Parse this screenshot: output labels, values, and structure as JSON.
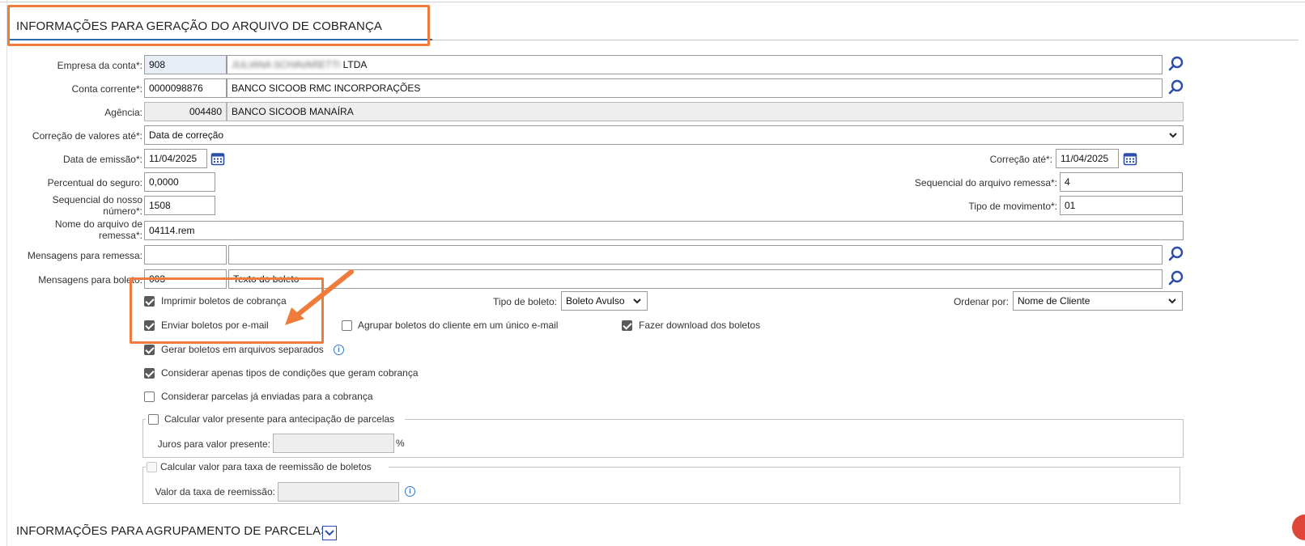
{
  "section": {
    "title": "INFORMAÇÕES PARA GERAÇÃO DO ARQUIVO DE COBRANÇA",
    "next_title": "INFORMAÇÕES PARA AGRUPAMENTO DE PARCELAS"
  },
  "empresa": {
    "label": "Empresa da conta*:",
    "code": "908",
    "name_blurred": "JULIANA SCHAVARETTI",
    "name_suffix": "LTDA"
  },
  "conta": {
    "label": "Conta corrente*:",
    "code": "0000098876",
    "name": "BANCO SICOOB RMC INCORPORAÇÕES"
  },
  "agencia": {
    "label": "Agência:",
    "code": "004480",
    "name": "BANCO SICOOB MANAÍRA"
  },
  "correcao_valores": {
    "label": "Correção de valores até*:",
    "value": "Data de correção"
  },
  "data_emissao": {
    "label": "Data de emissão*:",
    "value": "11/04/2025"
  },
  "correcao_ate": {
    "label": "Correção até*:",
    "value": "11/04/2025"
  },
  "percentual_seguro": {
    "label": "Percentual do seguro:",
    "value": "0,0000"
  },
  "sequencial_arquivo": {
    "label": "Sequencial do arquivo remessa*:",
    "value": "4"
  },
  "sequencial_nosso": {
    "label_line1": "Sequencial do nosso",
    "label_line2": "número*:",
    "value": "1508"
  },
  "tipo_movimento": {
    "label": "Tipo de movimento*:",
    "value": "01"
  },
  "nome_arquivo": {
    "label_line1": "Nome do arquivo de",
    "label_line2": "remessa*:",
    "value": "04114.rem"
  },
  "mensagens_remessa": {
    "label": "Mensagens para remessa:",
    "code": "",
    "text": ""
  },
  "mensagens_boleto": {
    "label": "Mensagens para boleto:",
    "code": "003",
    "text": "Texto do boleto"
  },
  "checkboxes": {
    "imprimir": "Imprimir boletos de cobrança",
    "enviar_email": "Enviar boletos por e-mail",
    "agrupar": "Agrupar boletos do cliente em um único e-mail",
    "download": "Fazer download dos boletos",
    "separados": "Gerar boletos em arquivos separados",
    "considerar_tipos": "Considerar apenas tipos de condições que geram cobrança",
    "considerar_parcelas": "Considerar parcelas já enviadas para a cobrança"
  },
  "tipo_boleto": {
    "label": "Tipo de boleto:",
    "value": "Boleto Avulso"
  },
  "ordenar": {
    "label": "Ordenar por:",
    "value": "Nome de Cliente"
  },
  "valor_presente": {
    "legend": "Calcular valor presente para antecipação de parcelas",
    "juros_label": "Juros para valor presente:",
    "unit": "%"
  },
  "reemissao": {
    "legend": "Calcular valor para taxa de reemissão de boletos",
    "valor_label": "Valor da taxa de reemissão:"
  },
  "colors": {
    "accent": "#f07c3b",
    "link_blue": "#2c4ea8",
    "underline": "#2c6aa8"
  }
}
